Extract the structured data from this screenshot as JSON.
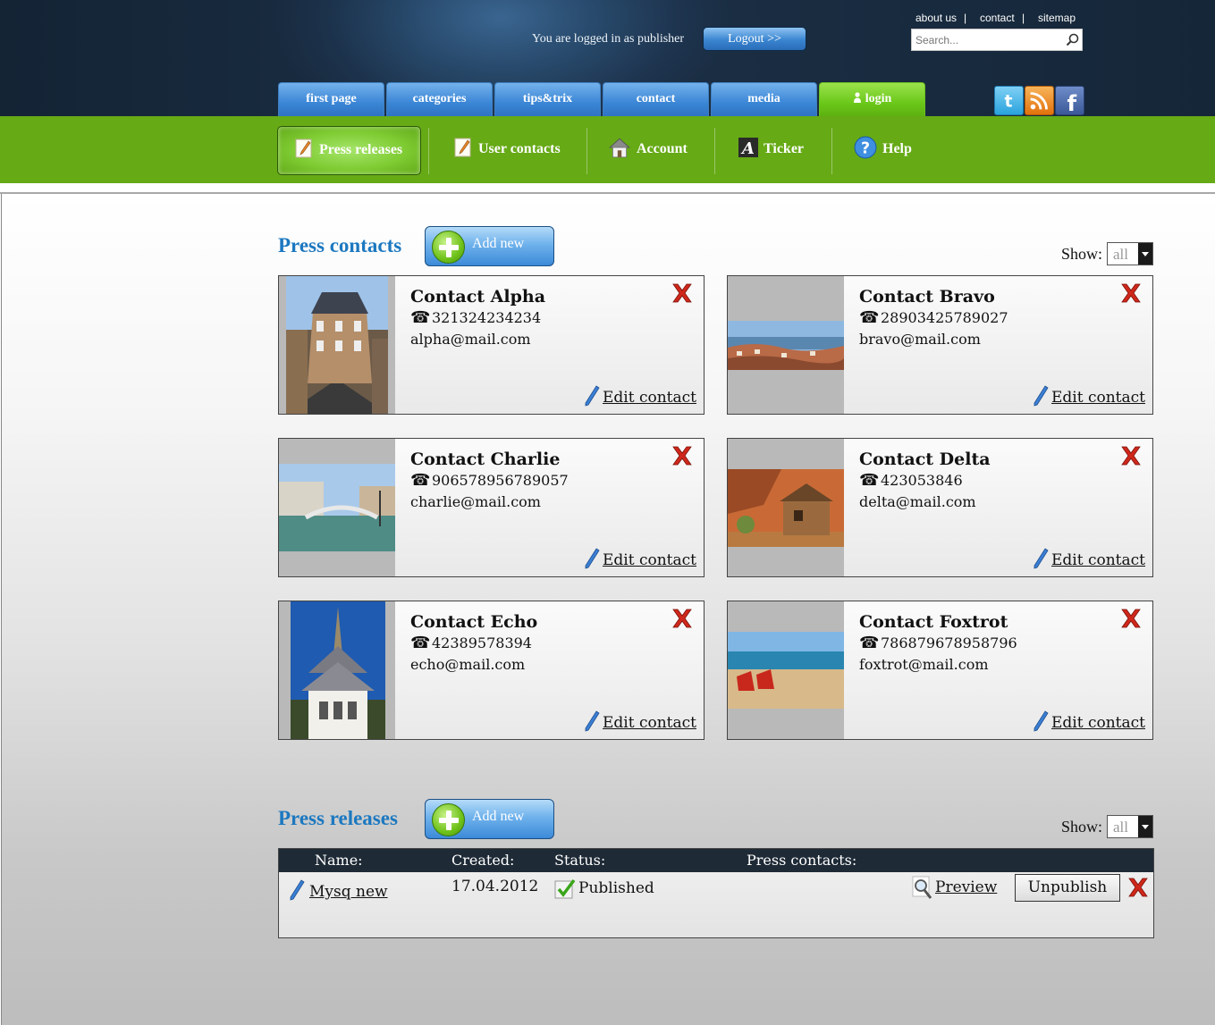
{
  "header": {
    "top_links": [
      "about us",
      "contact",
      "sitemap"
    ],
    "login_status": "You are logged in as publisher",
    "logout_label": "Logout >>",
    "search_placeholder": "Search..."
  },
  "nav": {
    "tabs": [
      "first page",
      "categories",
      "tips&trix",
      "contact",
      "media",
      "login"
    ],
    "active": "login"
  },
  "social_icons": [
    "twitter-icon",
    "rss-icon",
    "facebook-icon"
  ],
  "subnav": {
    "items": [
      "Press releases",
      "User contacts",
      "Account",
      "Ticker",
      "Help"
    ],
    "icons": [
      "notepad-icon",
      "notepad-icon",
      "house-icon",
      "font-icon",
      "help-icon"
    ],
    "active": "Press releases"
  },
  "press_contacts": {
    "title": "Press contacts",
    "add_label": "Add new",
    "show_label": "Show:",
    "show_value": "all",
    "edit_label": "Edit contact",
    "contacts": [
      {
        "name": "Contact Alpha",
        "phone": "321324234234",
        "email": "alpha@mail.com",
        "photo": "street-building-photo"
      },
      {
        "name": "Contact Bravo",
        "phone": "28903425789027",
        "email": "bravo@mail.com",
        "photo": "coastal-town-photo"
      },
      {
        "name": "Contact Charlie",
        "phone": "906578956789057",
        "email": "charlie@mail.com",
        "photo": "canal-bridge-photo"
      },
      {
        "name": "Contact Delta",
        "phone": "423053846",
        "email": "delta@mail.com",
        "photo": "log-cabin-photo"
      },
      {
        "name": "Contact Echo",
        "phone": "42389578394",
        "email": "echo@mail.com",
        "photo": "temple-photo"
      },
      {
        "name": "Contact Foxtrot",
        "phone": "786879678958796",
        "email": "foxtrot@mail.com",
        "photo": "beach-chairs-photo"
      }
    ]
  },
  "press_releases": {
    "title": "Press releases",
    "add_label": "Add new",
    "show_label": "Show:",
    "show_value": "all",
    "columns": [
      "Name:",
      "Created:",
      "Status:",
      "Press contacts:"
    ],
    "rows": [
      {
        "name": "Mysq new",
        "created": "17.04.2012",
        "status": "Published",
        "preview_label": "Preview",
        "unpublish_label": "Unpublish"
      }
    ]
  },
  "colors": {
    "brand_blue": "#1c78c0",
    "nav_green": "#66aa16",
    "header_navy": "#1e3550",
    "delete_red": "#d0281c"
  }
}
